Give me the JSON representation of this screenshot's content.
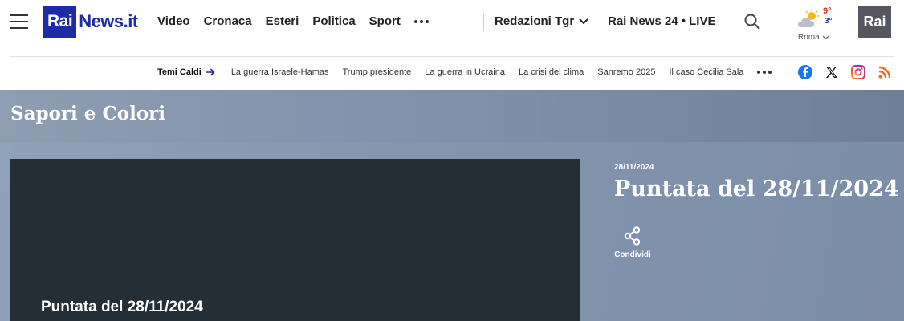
{
  "header": {
    "logo_rai": "Rai",
    "logo_news": "News.it",
    "nav": [
      "Video",
      "Cronaca",
      "Esteri",
      "Politica",
      "Sport"
    ],
    "redazioni": "Redazioni Tgr",
    "live": "Rai News 24 • LIVE",
    "weather": {
      "max": "9°",
      "min": "3°",
      "city": "Roma"
    },
    "corner_logo": "Rai"
  },
  "subnav": {
    "label": "Temi Caldi",
    "items": [
      "La guerra Israele-Hamas",
      "Trump presidente",
      "La guerra in Ucraina",
      "La crisi del clima",
      "Sanremo 2025",
      "Il caso Cecilia Sala"
    ]
  },
  "social": [
    "facebook-icon",
    "x-icon",
    "instagram-icon",
    "rss-icon"
  ],
  "colors": {
    "brand_blue": "#1d2ba6",
    "video_bg": "#232e37"
  },
  "program": {
    "title": "Sapori e Colori"
  },
  "episode": {
    "date": "28/11/2024",
    "title": "Puntata del 28/11/2024",
    "video_caption": "Puntata del 28/11/2024",
    "share_label": "Condividi"
  }
}
